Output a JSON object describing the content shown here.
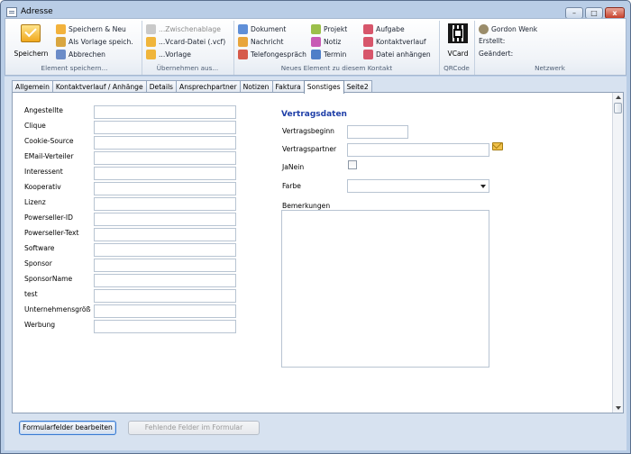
{
  "window": {
    "title": "Adresse",
    "min": "–",
    "max": "□",
    "close": "x"
  },
  "ribbon": {
    "groups": {
      "speichern": {
        "big_label": "Speichern",
        "items": [
          "Speichern & Neu",
          "Als Vorlage speich.",
          "Abbrechen"
        ],
        "label": "Element speichern..."
      },
      "uebernehmen": {
        "items": [
          "...Zwischenablage",
          "...Vcard-Datei (.vcf)",
          "...Vorlage"
        ],
        "label": "Übernehmen aus..."
      },
      "neues": {
        "col1": [
          "Dokument",
          "Nachricht",
          "Telefongespräch"
        ],
        "col2": [
          "Projekt",
          "Notiz",
          "Termin"
        ],
        "col3": [
          "Aufgabe",
          "Kontaktverlauf",
          "Datei anhängen"
        ],
        "label": "Neues Element zu diesem Kontakt"
      },
      "qrcode": {
        "big_label": "VCard",
        "label": "QRCode"
      },
      "netzwerk": {
        "user": "Gordon Wenk",
        "created": "Erstellt:",
        "changed": "Geändert:",
        "label": "Netzwerk"
      }
    }
  },
  "tabs": [
    "Allgemein",
    "Kontaktverlauf / Anhänge",
    "Details",
    "Ansprechpartner",
    "Notizen",
    "Faktura",
    "Sonstiges",
    "Seite2"
  ],
  "active_tab": "Sonstiges",
  "fields_left": [
    "Angestellte",
    "Clique",
    "Cookie-Source",
    "EMail-Verteiler",
    "Interessent",
    "Kooperativ",
    "Lizenz",
    "Powerseller-ID",
    "Powerseller-Text",
    "Software",
    "Sponsor",
    "SponsorName",
    "test",
    "Unternehmensgröße",
    "Werbung"
  ],
  "vertrag": {
    "title": "Vertragsdaten",
    "beginn": "Vertragsbeginn",
    "partner": "Vertragspartner",
    "janein": "JaNein",
    "farbe": "Farbe",
    "bemerkungen": "Bemerkungen"
  },
  "buttons": {
    "edit": "Formularfelder bearbeiten",
    "missing": "Fehlende Felder im Formular"
  },
  "colors": {
    "accent_title": "#1f3fa8",
    "window_frame": "#b9cde6"
  },
  "icons": {
    "save": "save-icon",
    "qr": "qrcode-icon",
    "user": "user-icon",
    "envelope": "envelope-icon"
  }
}
